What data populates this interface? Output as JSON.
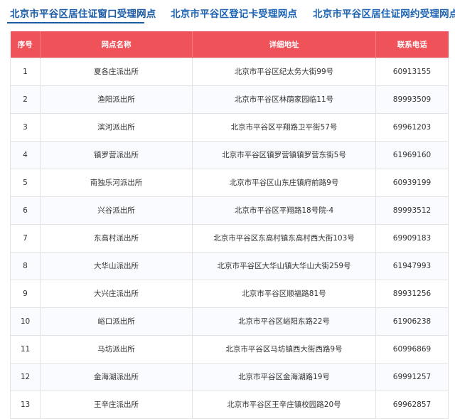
{
  "tabs": [
    {
      "label": "北京市平谷区居住证窗口受理网点",
      "active": true
    },
    {
      "label": "北京市平谷区登记卡受理网点",
      "active": false
    },
    {
      "label": "北京市平谷区居住证网约受理网点",
      "active": false
    }
  ],
  "table": {
    "headers": [
      "序号",
      "网点名称",
      "详细地址",
      "联系电话"
    ],
    "rows": [
      [
        "1",
        "夏各庄派出所",
        "北京市平谷区纪太务大街99号",
        "60913155"
      ],
      [
        "2",
        "渔阳派出所",
        "北京市平谷区林荫家园临11号",
        "89993509"
      ],
      [
        "3",
        "滨河派出所",
        "北京市平谷区平翔路卫平街57号",
        "69961203"
      ],
      [
        "4",
        "镇罗营派出所",
        "北京市平谷区镇罗营镇镇罗营东街5号",
        "61969160"
      ],
      [
        "5",
        "南独乐河派出所",
        "北京市平谷区山东庄镇府前路9号",
        "60939199"
      ],
      [
        "6",
        "兴谷派出所",
        "北京市平谷区平翔路18号院-4",
        "89993512"
      ],
      [
        "7",
        "东高村派出所",
        "北京市平谷区东高村镇东高村西大街103号",
        "69909183"
      ],
      [
        "8",
        "大华山派出所",
        "北京市平谷区大华山镇大华山大街259号",
        "61947993"
      ],
      [
        "9",
        "大兴庄派出所",
        "北京市平谷区顺福路81号",
        "89931256"
      ],
      [
        "10",
        "峪口派出所",
        "北京市平谷区峪阳东路22号",
        "61906238"
      ],
      [
        "11",
        "马坊派出所",
        "北京市平谷区马坊镇西大街西路9号",
        "60996869"
      ],
      [
        "12",
        "金海湖派出所",
        "北京市平谷区金海湖路19号",
        "69991257"
      ],
      [
        "13",
        "王辛庄派出所",
        "北京市平谷区王辛庄镇校园路20号",
        "69962857"
      ]
    ]
  },
  "colors": {
    "header_bg": "#f0525a",
    "tab_text": "#1c63b3",
    "active_underline": "#1a5ba6"
  }
}
